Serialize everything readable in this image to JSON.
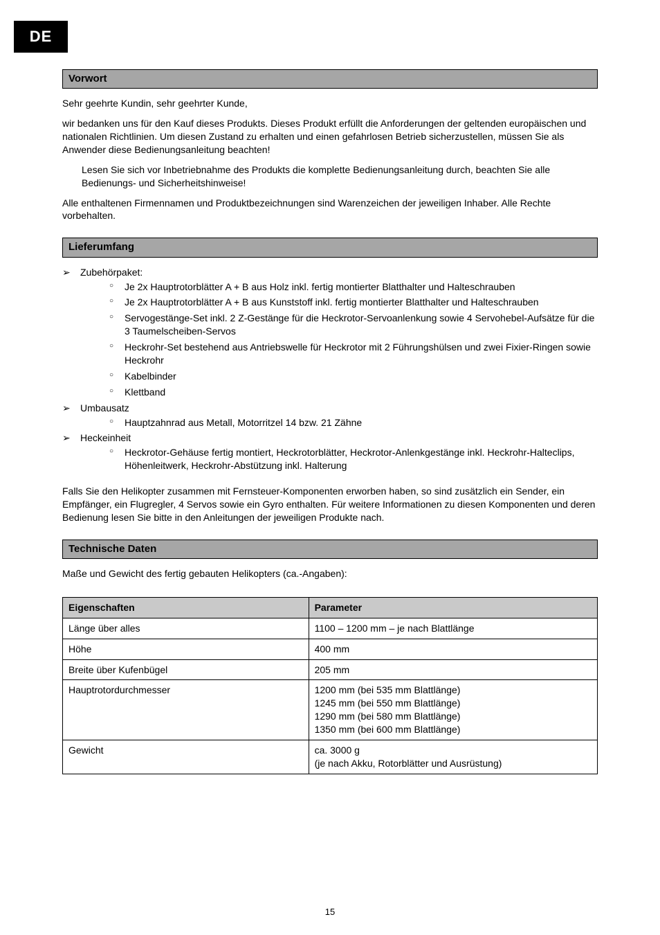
{
  "lang_tab": "DE",
  "section1": {
    "heading": "Vorwort",
    "p1": "Sehr geehrte Kundin, sehr geehrter Kunde,",
    "p2": "wir bedanken uns für den Kauf dieses Produkts. Dieses Produkt erfüllt die Anforderungen der geltenden europäischen und nationalen Richtlinien. Um diesen Zustand zu erhalten und einen gefahrlosen Betrieb sicherzustellen, müssen Sie als Anwender diese Bedienungsanleitung beachten!",
    "p3": "Lesen Sie sich vor Inbetriebnahme des Produkts die komplette Bedienungsanleitung durch, beachten Sie alle Bedienungs- und Sicherheitshinweise!",
    "p4": "Alle enthaltenen Firmennamen und Produktbezeichnungen sind Warenzeichen der jeweiligen Inhaber. Alle Rechte vorbehalten."
  },
  "section2": {
    "heading": "Lieferumfang",
    "items": [
      {
        "label": "Zubehörpaket:",
        "sub": [
          "Je 2x Hauptrotorblätter A + B aus Holz inkl. fertig montierter Blatthalter und Halteschrauben",
          "Je 2x Hauptrotorblätter A + B aus Kunststoff inkl. fertig montierter Blatthalter und Halteschrauben",
          "Servogestänge-Set inkl. 2 Z-Gestänge für die Heckrotor-Servoanlenkung sowie 4 Servohebel-Aufsätze für die 3 Taumelscheiben-Servos",
          "Heckrohr-Set bestehend aus Antriebswelle für Heckrotor mit 2 Führungshülsen und zwei Fixier-Ringen sowie Heckrohr",
          "Kabelbinder",
          "Klettband"
        ]
      },
      {
        "label": "Umbausatz",
        "sub": [
          "Hauptzahnrad aus Metall, Motorritzel 14 bzw. 21 Zähne"
        ]
      },
      {
        "label": "Heckeinheit",
        "sub": [
          "Heckrotor-Gehäuse fertig montiert, Heckrotorblätter, Heckrotor-Anlenkgestänge inkl. Heckrohr-Halteclips, Höhenleitwerk, Heckrohr-Abstützung inkl. Halterung"
        ]
      }
    ],
    "footer": "Falls Sie den Helikopter zusammen mit Fernsteuer-Komponenten erworben haben, so sind zusätzlich ein Sender, ein Empfänger, ein Flugregler, 4 Servos sowie ein Gyro enthalten. Für weitere Informationen zu diesen Komponenten und deren Bedienung lesen Sie bitte in den Anleitungen der jeweiligen Produkte nach."
  },
  "section3": {
    "heading": "Technische Daten",
    "intro": "Maße und Gewicht des fertig gebauten Helikopters (ca.-Angaben):",
    "columns": [
      "Eigenschaften",
      "Parameter"
    ],
    "rows": [
      {
        "k": "Länge über alles",
        "v": "1100 – 1200 mm – je nach Blattlänge"
      },
      {
        "k": "Höhe",
        "v": "400 mm"
      },
      {
        "k": "Breite über Kufenbügel",
        "v": "205 mm"
      },
      {
        "k": "Hauptrotordurchmesser",
        "v": "1200 mm (bei 535 mm Blattlänge)\n1245 mm (bei 550 mm Blattlänge)\n1290 mm (bei 580 mm Blattlänge)\n1350 mm (bei 600 mm Blattlänge)"
      },
      {
        "k": "Gewicht",
        "v": "ca. 3000 g\n(je nach Akku, Rotorblätter und Ausrüstung)"
      }
    ]
  },
  "page_number": "15"
}
